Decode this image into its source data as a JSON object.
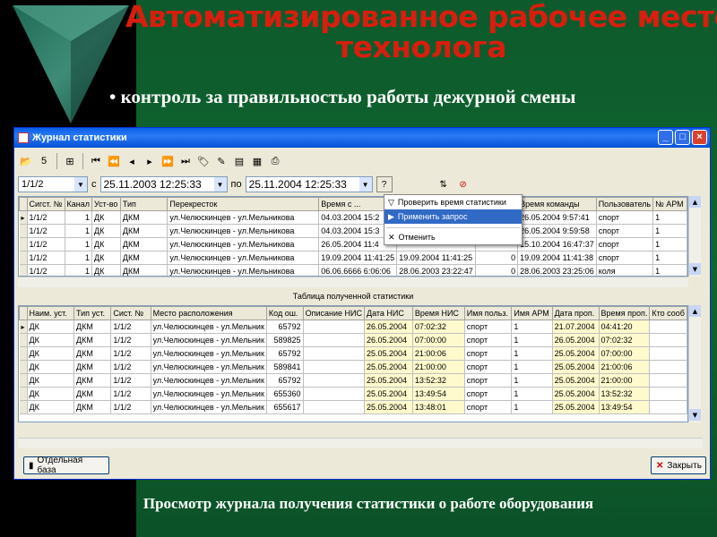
{
  "slide": {
    "title_line1": "Автоматизированное рабочее место",
    "title_line2": "технолога",
    "bullet": "• контроль за правильностью работы дежурной смены",
    "caption": "Просмотр журнала получения статистики о работе оборудования"
  },
  "window": {
    "title": "Журнал статистики",
    "controls": [
      "_",
      "□",
      "×"
    ]
  },
  "filter": {
    "node_value": "1/1/2",
    "from_label": "с",
    "from_value": "25.11.2003  12:25:33",
    "to_label": "по",
    "to_value": "25.11.2004  12:25:33"
  },
  "context_menu": {
    "items": [
      {
        "icon": "filter-icon",
        "label": "Проверить время статистики"
      },
      {
        "icon": "apply-icon",
        "label": "Применить запрос"
      },
      {
        "icon": "cancel-icon",
        "label": "Отменить"
      }
    ]
  },
  "table1": {
    "columns": [
      "",
      "Сигст. №",
      "Канал",
      "Уст-во",
      "Тип",
      "Перекресток",
      "Время с ...",
      "",
      "",
      "Время команды",
      "Пользователь",
      "№ АРМ"
    ],
    "rows": [
      [
        "▸",
        "1/1/2",
        "1",
        "ДК",
        "ДКМ",
        "ул.Челюскинцев - ул.Мельникова",
        "04.03.2004 15:2",
        "",
        "",
        "26.05.2004 9:57:41",
        "спорт",
        "1"
      ],
      [
        "",
        "1/1/2",
        "1",
        "ДК",
        "ДКМ",
        "ул.Челюскинцев - ул.Мельникова",
        "04.03.2004 15:3",
        "",
        "",
        "26.05.2004 9:59:58",
        "спорт",
        "1"
      ],
      [
        "",
        "1/1/2",
        "1",
        "ДК",
        "ДКМ",
        "ул.Челюскинцев - ул.Мельникова",
        "26.05.2004 11:4",
        "",
        "",
        "15.10.2004 16:47:37",
        "спорт",
        "1"
      ],
      [
        "",
        "1/1/2",
        "1",
        "ДК",
        "ДКМ",
        "ул.Челюскинцев - ул.Мельникова",
        "19.09.2004 11:41:25",
        "19.09.2004 11:41:25",
        "0",
        "19.09.2004 11:41:38",
        "спорт",
        "1"
      ],
      [
        "",
        "1/1/2",
        "1",
        "ДК",
        "ДКМ",
        "ул.Челюскинцев - ул.Мельникова",
        "06.06.6666 6:06:06",
        "28.06.2003 23:22:47",
        "0",
        "28.06.2003 23:25:06",
        "коля",
        "1"
      ]
    ]
  },
  "table2": {
    "title": "Таблица полученной статистики",
    "columns": [
      "",
      "Наим. уст.",
      "Тип уст.",
      "Сист. №",
      "Место расположения",
      "Код ош.",
      "Описание НИС",
      "Дата НИС",
      "Время НИС",
      "Имя польз.",
      "Имя АРМ",
      "Дата проп.",
      "Время проп.",
      "Кто сооб"
    ],
    "rows": [
      [
        "▸",
        "ДК",
        "ДКМ",
        "1/1/2",
        "ул.Челюскинцев - ул.Мельник",
        "65792",
        "",
        "26.05.2004",
        "07:02:32",
        "спорт",
        "1",
        "21.07.2004",
        "04:41:20",
        ""
      ],
      [
        "",
        "ДК",
        "ДКМ",
        "1/1/2",
        "ул.Челюскинцев - ул.Мельник",
        "589825",
        "",
        "26.05.2004",
        "07:00:00",
        "спорт",
        "1",
        "26.05.2004",
        "07:02:32",
        ""
      ],
      [
        "",
        "ДК",
        "ДКМ",
        "1/1/2",
        "ул.Челюскинцев - ул.Мельник",
        "65792",
        "",
        "25.05.2004",
        "21:00:06",
        "спорт",
        "1",
        "25.05.2004",
        "07:00:00",
        ""
      ],
      [
        "",
        "ДК",
        "ДКМ",
        "1/1/2",
        "ул.Челюскинцев - ул.Мельник",
        "589841",
        "",
        "25.05.2004",
        "21:00:00",
        "спорт",
        "1",
        "25.05.2004",
        "21:00:06",
        ""
      ],
      [
        "",
        "ДК",
        "ДКМ",
        "1/1/2",
        "ул.Челюскинцев - ул.Мельник",
        "65792",
        "",
        "25.05.2004",
        "13:52:32",
        "спорт",
        "1",
        "25.05.2004",
        "21:00:00",
        ""
      ],
      [
        "",
        "ДК",
        "ДКМ",
        "1/1/2",
        "ул.Челюскинцев - ул.Мельник",
        "655360",
        "",
        "25.05.2004",
        "13:49:54",
        "спорт",
        "1",
        "25.05.2004",
        "13:52:32",
        ""
      ],
      [
        "",
        "ДК",
        "ДКМ",
        "1/1/2",
        "ул.Челюскинцев - ул.Мельник",
        "655617",
        "",
        "25.05.2004",
        "13:48:01",
        "спорт",
        "1",
        "25.05.2004",
        "13:49:54",
        ""
      ]
    ]
  },
  "buttons": {
    "separate_db": "Отдельная база",
    "close": "Закрыть"
  },
  "colors": {
    "slide_green": "#10672f",
    "title_red": "#d81e0e",
    "xp_blue": "#0a5fe8",
    "highlight": "#fffacd"
  }
}
